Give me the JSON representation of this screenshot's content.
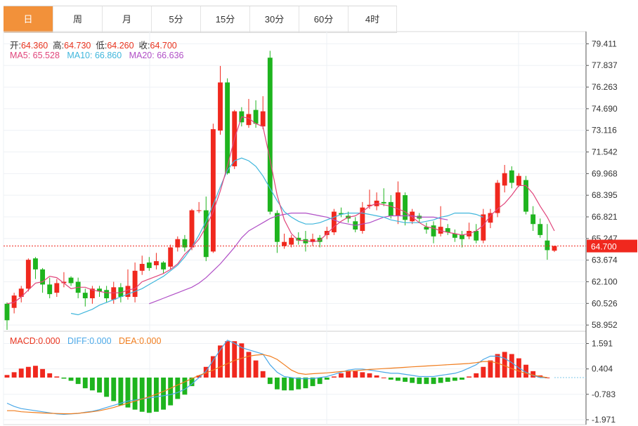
{
  "tabs": [
    "日",
    "周",
    "月",
    "5分",
    "15分",
    "30分",
    "60分",
    "4时"
  ],
  "active_tab": 0,
  "ohlc_info": {
    "open_label": "开:",
    "open": "64.360",
    "high_label": "高:",
    "high": "64.730",
    "low_label": "低:",
    "low": "64.260",
    "close_label": "收:",
    "close": "64.700"
  },
  "ma_info": {
    "ma5_label": "MA5:",
    "ma5": "65.528",
    "ma10_label": "MA10:",
    "ma10": "66.860",
    "ma20_label": "MA20:",
    "ma20": "66.636"
  },
  "macd_info": {
    "macd_label": "MACD:",
    "macd": "0.000",
    "diff_label": "DIFF:",
    "diff": "0.000",
    "dea_label": "DEA:",
    "dea": "0.000"
  },
  "colors": {
    "up": "#f0281e",
    "down": "#1eb41e",
    "ma5": "#e0457b",
    "ma10": "#3fb6dc",
    "ma20": "#b04fc6",
    "diff": "#4aa8e8",
    "dea": "#f07d1e",
    "price_tag": "#f0281e",
    "label_default": "#333333",
    "value_red": "#e8331e"
  },
  "chart_data": {
    "type": "candlestick",
    "price_ticks": [
      79.411,
      77.837,
      76.263,
      74.69,
      73.116,
      71.542,
      69.968,
      68.395,
      66.821,
      65.247,
      63.674,
      62.1,
      60.526,
      58.952
    ],
    "price_tick_labels": [
      "79.411",
      "77.837",
      "76.263",
      "74.690",
      "73.116",
      "71.542",
      "69.968",
      "68.395",
      "66.821",
      "65.247",
      "63.674",
      "62.100",
      "60.526",
      "58.952"
    ],
    "price_ylim": [
      58.5,
      80.3
    ],
    "last_price_label": "64.700",
    "last_price": 64.7,
    "candles": [
      [
        60.5,
        59.3,
        60.6,
        58.6
      ],
      [
        60.2,
        61.1,
        61.3,
        59.8
      ],
      [
        61.0,
        61.6,
        61.8,
        60.6
      ],
      [
        61.6,
        63.7,
        63.8,
        61.4
      ],
      [
        63.8,
        63.0,
        63.9,
        62.3
      ],
      [
        63.0,
        61.9,
        63.1,
        61.3
      ],
      [
        61.9,
        61.2,
        62.4,
        60.9
      ],
      [
        61.3,
        62.0,
        62.3,
        61.0
      ],
      [
        62.0,
        62.1,
        62.8,
        61.7
      ],
      [
        62.4,
        62.0,
        62.5,
        61.8
      ],
      [
        62.1,
        61.3,
        62.4,
        60.9
      ],
      [
        61.3,
        60.9,
        61.6,
        60.3
      ],
      [
        60.9,
        61.6,
        61.8,
        60.5
      ],
      [
        61.6,
        61.4,
        61.8,
        61.0
      ],
      [
        61.5,
        60.9,
        61.8,
        60.6
      ],
      [
        60.8,
        61.7,
        62.1,
        60.5
      ],
      [
        61.7,
        61.0,
        62.0,
        60.6
      ],
      [
        61.0,
        61.8,
        63.0,
        60.8
      ],
      [
        61.0,
        62.9,
        63.5,
        60.6
      ],
      [
        62.9,
        63.4,
        64.0,
        62.6
      ],
      [
        63.5,
        63.1,
        63.9,
        62.9
      ],
      [
        63.3,
        63.6,
        64.2,
        63.0
      ],
      [
        63.5,
        63.0,
        63.6,
        62.7
      ],
      [
        63.2,
        64.6,
        64.8,
        63.0
      ],
      [
        64.6,
        65.2,
        65.4,
        64.3
      ],
      [
        65.2,
        64.6,
        65.5,
        64.3
      ],
      [
        64.6,
        67.3,
        67.4,
        64.4
      ],
      [
        67.3,
        67.3,
        67.9,
        67.1
      ],
      [
        67.3,
        63.9,
        68.3,
        63.6
      ],
      [
        64.3,
        73.2,
        73.6,
        64.2
      ],
      [
        73.1,
        76.6,
        77.8,
        72.8
      ],
      [
        76.6,
        70.0,
        76.9,
        69.9
      ],
      [
        70.5,
        74.5,
        74.6,
        70.3
      ],
      [
        74.5,
        73.7,
        74.8,
        73.4
      ],
      [
        73.5,
        74.3,
        75.4,
        73.3
      ],
      [
        74.6,
        73.6,
        75.3,
        73.3
      ],
      [
        73.4,
        74.5,
        75.6,
        73.2
      ],
      [
        78.4,
        67.2,
        78.9,
        67.0
      ],
      [
        67.1,
        65.0,
        67.3,
        64.2
      ],
      [
        64.7,
        65.0,
        65.6,
        64.5
      ],
      [
        64.8,
        65.3,
        65.5,
        64.6
      ],
      [
        65.3,
        65.1,
        65.7,
        64.8
      ],
      [
        65.2,
        64.9,
        65.8,
        64.3
      ],
      [
        65.0,
        65.2,
        65.6,
        64.7
      ],
      [
        65.3,
        65.0,
        65.5,
        64.6
      ],
      [
        65.5,
        65.8,
        66.1,
        65.2
      ],
      [
        65.7,
        67.2,
        67.4,
        65.5
      ],
      [
        67.1,
        67.0,
        67.5,
        66.8
      ],
      [
        66.9,
        66.7,
        67.2,
        66.4
      ],
      [
        66.5,
        65.9,
        66.8,
        65.7
      ],
      [
        65.8,
        67.5,
        67.9,
        65.6
      ],
      [
        67.6,
        67.7,
        68.8,
        67.4
      ],
      [
        67.6,
        68.0,
        68.6,
        67.3
      ],
      [
        67.9,
        67.8,
        68.9,
        67.6
      ],
      [
        67.9,
        66.9,
        68.4,
        66.7
      ],
      [
        66.9,
        68.6,
        69.4,
        66.3
      ],
      [
        68.4,
        66.6,
        68.6,
        66.2
      ],
      [
        66.5,
        67.2,
        67.4,
        66.3
      ],
      [
        66.9,
        66.7,
        67.1,
        66.4
      ],
      [
        66.1,
        65.9,
        66.4,
        65.6
      ],
      [
        66.2,
        65.4,
        66.5,
        64.9
      ],
      [
        65.6,
        66.1,
        67.6,
        65.4
      ],
      [
        66.0,
        65.7,
        66.3,
        65.5
      ],
      [
        65.6,
        65.3,
        65.9,
        65.0
      ],
      [
        65.5,
        65.2,
        65.8,
        64.6
      ],
      [
        65.4,
        65.8,
        66.4,
        65.2
      ],
      [
        65.8,
        65.1,
        66.3,
        64.9
      ],
      [
        65.1,
        67.0,
        67.4,
        64.9
      ],
      [
        66.4,
        67.1,
        67.4,
        66.0
      ],
      [
        67.1,
        69.3,
        69.5,
        66.8
      ],
      [
        69.1,
        70.0,
        70.6,
        68.6
      ],
      [
        70.2,
        69.3,
        70.5,
        68.9
      ],
      [
        69.1,
        69.8,
        70.0,
        69.0
      ],
      [
        69.5,
        67.2,
        69.8,
        67.0
      ],
      [
        67.0,
        66.3,
        67.6,
        65.8
      ],
      [
        66.3,
        65.5,
        66.7,
        65.3
      ],
      [
        65.1,
        64.4,
        66.3,
        63.7
      ],
      [
        64.36,
        64.7,
        64.73,
        64.26
      ]
    ],
    "ma5": [
      60.5,
      60.6,
      61.0,
      61.5,
      62.0,
      62.1,
      62.5,
      62.4,
      62.0,
      61.6,
      61.7,
      61.7,
      61.5,
      61.4,
      61.3,
      61.3,
      61.3,
      61.5,
      61.6,
      62.1,
      62.3,
      62.5,
      62.7,
      63.0,
      63.4,
      64.1,
      64.6,
      65.2,
      66.1,
      67.2,
      68.7,
      70.5,
      72.5,
      74.1,
      74.0,
      73.6,
      73.4,
      71.0,
      68.4,
      66.6,
      65.6,
      65.1,
      65.1,
      65.0,
      65.1,
      65.6,
      66.1,
      66.5,
      66.8,
      66.9,
      67.2,
      67.6,
      67.8,
      67.7,
      67.6,
      67.4,
      67.2,
      66.8,
      66.4,
      66.1,
      66.0,
      65.8,
      65.7,
      65.6,
      65.5,
      65.6,
      65.8,
      66.2,
      66.9,
      67.4,
      67.8,
      68.4,
      69.1,
      69.1,
      68.5,
      67.6,
      66.8,
      65.8
    ],
    "ma10": [
      null,
      null,
      null,
      null,
      null,
      null,
      null,
      null,
      null,
      59.8,
      59.7,
      59.9,
      60.1,
      60.4,
      60.6,
      60.8,
      61.0,
      61.2,
      61.4,
      61.6,
      61.9,
      62.2,
      62.5,
      62.9,
      63.3,
      63.9,
      64.6,
      65.5,
      66.5,
      67.7,
      69.0,
      70.2,
      70.9,
      71.1,
      70.9,
      70.5,
      69.8,
      68.9,
      68.0,
      67.2,
      66.8,
      66.5,
      66.3,
      66.3,
      66.4,
      66.6,
      66.8,
      67.0,
      67.1,
      67.1,
      67.1,
      67.0,
      66.9,
      66.8,
      66.6,
      66.5,
      66.4,
      66.4,
      66.4,
      66.5,
      66.6,
      66.8,
      66.9,
      67.1,
      67.1,
      67.1,
      67.0,
      66.8
    ],
    "ma20": [
      null,
      null,
      null,
      null,
      null,
      null,
      null,
      null,
      null,
      null,
      null,
      null,
      null,
      null,
      null,
      null,
      null,
      null,
      null,
      null,
      60.5,
      60.7,
      60.9,
      61.1,
      61.3,
      61.5,
      61.7,
      62.0,
      62.4,
      62.9,
      63.4,
      64.0,
      64.6,
      65.3,
      65.8,
      66.1,
      66.4,
      66.7,
      66.9,
      67.0,
      67.1,
      67.1,
      67.1,
      67.0,
      66.9,
      66.8,
      66.6,
      66.4,
      66.3,
      66.2,
      66.3,
      66.4,
      66.6,
      66.8,
      66.9,
      66.9,
      66.9,
      66.9,
      66.8,
      66.8,
      66.8,
      66.7,
      66.6
    ],
    "macd_ticks": [
      1.591,
      0.404,
      -0.783,
      -1.971
    ],
    "macd_tick_labels": [
      "1.591",
      "0.404",
      "-0.783",
      "-1.971"
    ],
    "macd_ylim": [
      -2.2,
      2.1
    ],
    "macd_hist": [
      0.12,
      0.25,
      0.42,
      0.5,
      0.55,
      0.4,
      0.2,
      0.05,
      -0.05,
      -0.15,
      -0.3,
      -0.5,
      -0.6,
      -0.7,
      -0.9,
      -1.1,
      -1.3,
      -1.4,
      -1.5,
      -1.6,
      -1.65,
      -1.6,
      -1.5,
      -1.3,
      -1.0,
      -0.8,
      -0.4,
      0.1,
      0.5,
      1.0,
      1.5,
      1.7,
      1.7,
      1.6,
      1.2,
      0.8,
      0.3,
      -0.3,
      -0.55,
      -0.6,
      -0.6,
      -0.55,
      -0.5,
      -0.4,
      -0.3,
      -0.1,
      0.05,
      0.2,
      0.3,
      0.3,
      0.25,
      0.2,
      0.1,
      0.0,
      -0.1,
      -0.15,
      -0.2,
      -0.25,
      -0.3,
      -0.3,
      -0.3,
      -0.25,
      -0.2,
      -0.15,
      -0.1,
      0.05,
      0.2,
      0.5,
      0.8,
      1.1,
      1.2,
      1.1,
      0.9,
      0.6,
      0.3,
      0.1,
      0.0
    ],
    "diff": [
      -1.2,
      -1.35,
      -1.45,
      -1.5,
      -1.55,
      -1.6,
      -1.65,
      -1.7,
      -1.72,
      -1.7,
      -1.68,
      -1.62,
      -1.58,
      -1.5,
      -1.4,
      -1.3,
      -1.2,
      -1.1,
      -1.05,
      -1.0,
      -0.95,
      -0.9,
      -0.85,
      -0.8,
      -0.7,
      -0.55,
      -0.3,
      0.0,
      0.3,
      0.8,
      1.3,
      1.75,
      1.6,
      1.4,
      1.3,
      1.2,
      1.1,
      0.6,
      0.25,
      0.05,
      0.0,
      -0.05,
      -0.05,
      -0.05,
      0.0,
      0.05,
      0.15,
      0.25,
      0.35,
      0.4,
      0.4,
      0.35,
      0.3,
      0.25,
      0.2,
      0.2,
      0.15,
      0.1,
      0.05,
      0.05,
      0.05,
      0.1,
      0.15,
      0.2,
      0.3,
      0.45,
      0.6,
      0.85,
      1.0,
      1.0,
      0.9,
      0.7,
      0.45,
      0.25,
      0.1,
      0.0,
      0.0
    ],
    "dea": [
      -1.55,
      -1.55,
      -1.6,
      -1.62,
      -1.64,
      -1.66,
      -1.67,
      -1.68,
      -1.69,
      -1.69,
      -1.67,
      -1.64,
      -1.6,
      -1.55,
      -1.48,
      -1.4,
      -1.3,
      -1.2,
      -1.1,
      -1.0,
      -0.9,
      -0.78,
      -0.65,
      -0.5,
      -0.35,
      -0.2,
      -0.05,
      0.1,
      0.22,
      0.35,
      0.5,
      0.65,
      0.8,
      0.9,
      1.0,
      1.05,
      1.08,
      1.0,
      0.85,
      0.6,
      0.35,
      0.2,
      0.15,
      0.18,
      0.2,
      0.22,
      0.25,
      0.28,
      0.3,
      0.32,
      0.35,
      0.38,
      0.4,
      0.42,
      0.44,
      0.46,
      0.48,
      0.5,
      0.52,
      0.54,
      0.56,
      0.58,
      0.6,
      0.62,
      0.64,
      0.66,
      0.7,
      0.75,
      0.75,
      0.68,
      0.55,
      0.42,
      0.3,
      0.2,
      0.12,
      0.05,
      0.0
    ],
    "grid": true
  }
}
